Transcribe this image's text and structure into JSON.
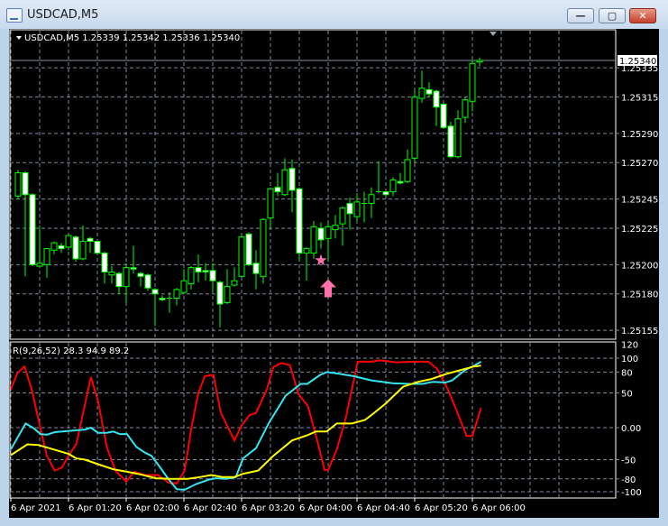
{
  "window": {
    "title": "USDCAD,M5",
    "minimize_label": "—",
    "maximize_label": "▢",
    "close_label": "✕"
  },
  "chart_data": [
    {
      "type": "candlestick",
      "title": "USDCAD,M5",
      "header_values": "1.25339 1.25342 1.25336 1.25340",
      "current_price": "1.25340",
      "y_ticks": [
        "1.25335",
        "1.25315",
        "1.25290",
        "1.25270",
        "1.25245",
        "1.25225",
        "1.25200",
        "1.25180",
        "1.25155"
      ],
      "ylim": [
        1.2515,
        1.2534
      ],
      "colors": {
        "bull": "#00ff00",
        "bear_fill": "#ffffff",
        "grid": "#7d8a9c",
        "current_line": "#8a94a0"
      },
      "candles_ohlc": [
        [
          1.25247,
          1.25265,
          1.25245,
          1.25263
        ],
        [
          1.25263,
          1.25264,
          1.25192,
          1.25248
        ],
        [
          1.25248,
          1.25249,
          1.25199,
          1.252
        ],
        [
          1.25199,
          1.25227,
          1.25198,
          1.25201
        ],
        [
          1.252,
          1.25211,
          1.25191,
          1.25211
        ],
        [
          1.2521,
          1.25216,
          1.25207,
          1.25215
        ],
        [
          1.25213,
          1.25215,
          1.25208,
          1.25211
        ],
        [
          1.25212,
          1.25221,
          1.2521,
          1.2522
        ],
        [
          1.25219,
          1.2522,
          1.25202,
          1.25204
        ],
        [
          1.25204,
          1.25227,
          1.25203,
          1.25216
        ],
        [
          1.25218,
          1.25219,
          1.25208,
          1.25216
        ],
        [
          1.25216,
          1.25216,
          1.25207,
          1.25208
        ],
        [
          1.25208,
          1.25209,
          1.25187,
          1.25195
        ],
        [
          1.25193,
          1.25199,
          1.25187,
          1.25195
        ],
        [
          1.25194,
          1.25195,
          1.2518,
          1.25185
        ],
        [
          1.25185,
          1.25201,
          1.25174,
          1.25198
        ],
        [
          1.25198,
          1.25213,
          1.25194,
          1.25197
        ],
        [
          1.25194,
          1.25195,
          1.25185,
          1.25192
        ],
        [
          1.25193,
          1.25194,
          1.25182,
          1.25184
        ],
        [
          1.25183,
          1.25184,
          1.25158,
          1.2518
        ],
        [
          1.25177,
          1.25179,
          1.25175,
          1.25176
        ],
        [
          1.25177,
          1.25181,
          1.25167,
          1.25177
        ],
        [
          1.25177,
          1.25184,
          1.25172,
          1.25183
        ],
        [
          1.25181,
          1.25197,
          1.2518,
          1.25189
        ],
        [
          1.25187,
          1.25199,
          1.25183,
          1.25198
        ],
        [
          1.25198,
          1.25207,
          1.25188,
          1.25195
        ],
        [
          1.25196,
          1.25201,
          1.25189,
          1.25195
        ],
        [
          1.25196,
          1.25201,
          1.25181,
          1.25189
        ],
        [
          1.25188,
          1.25189,
          1.25157,
          1.25173
        ],
        [
          1.25174,
          1.25197,
          1.25173,
          1.25185
        ],
        [
          1.25186,
          1.25198,
          1.25185,
          1.25189
        ],
        [
          1.25192,
          1.25221,
          1.25191,
          1.25219
        ],
        [
          1.25221,
          1.25222,
          1.25199,
          1.252
        ],
        [
          1.25201,
          1.2521,
          1.25183,
          1.25194
        ],
        [
          1.25192,
          1.25232,
          1.25187,
          1.25231
        ],
        [
          1.25232,
          1.25253,
          1.25225,
          1.25252
        ],
        [
          1.25253,
          1.25263,
          1.25247,
          1.2525
        ],
        [
          1.25248,
          1.25273,
          1.25247,
          1.25265
        ],
        [
          1.25266,
          1.25272,
          1.25236,
          1.25251
        ],
        [
          1.25252,
          1.25253,
          1.25202,
          1.25208
        ],
        [
          1.25208,
          1.25212,
          1.25189,
          1.25211
        ],
        [
          1.25208,
          1.2523,
          1.25204,
          1.25226
        ],
        [
          1.25225,
          1.25229,
          1.25211,
          1.25217
        ],
        [
          1.25218,
          1.2523,
          1.25202,
          1.25226
        ],
        [
          1.25224,
          1.25234,
          1.25218,
          1.25227
        ],
        [
          1.25228,
          1.2524,
          1.25213,
          1.25239
        ],
        [
          1.25242,
          1.25246,
          1.25224,
          1.25235
        ],
        [
          1.25233,
          1.25249,
          1.2523,
          1.25243
        ],
        [
          1.25242,
          1.2525,
          1.25229,
          1.25242
        ],
        [
          1.25242,
          1.25253,
          1.25232,
          1.25248
        ],
        [
          1.2525,
          1.25271,
          1.25249,
          1.2525
        ],
        [
          1.2525,
          1.25251,
          1.25247,
          1.25248
        ],
        [
          1.2525,
          1.2526,
          1.25247,
          1.25258
        ],
        [
          1.25257,
          1.25263,
          1.25255,
          1.25256
        ],
        [
          1.25257,
          1.25279,
          1.25256,
          1.25272
        ],
        [
          1.25273,
          1.2532,
          1.2527,
          1.25315
        ],
        [
          1.25314,
          1.25333,
          1.25311,
          1.25321
        ],
        [
          1.2532,
          1.25325,
          1.25315,
          1.25317
        ],
        [
          1.25319,
          1.2532,
          1.25295,
          1.25308
        ],
        [
          1.2531,
          1.25311,
          1.25293,
          1.25294
        ],
        [
          1.25295,
          1.25298,
          1.25273,
          1.25274
        ],
        [
          1.25274,
          1.25306,
          1.25273,
          1.253
        ],
        [
          1.25301,
          1.25315,
          1.25297,
          1.25313
        ],
        [
          1.25312,
          1.2534,
          1.25305,
          1.25338
        ],
        [
          1.25339,
          1.25342,
          1.25336,
          1.2534
        ]
      ],
      "signals": [
        {
          "type": "star",
          "bar": 42,
          "price": 1.25203,
          "color": "#ff6fae"
        },
        {
          "type": "up-arrow",
          "bar": 43,
          "price": 1.2519,
          "color": "#ff6fae"
        }
      ]
    },
    {
      "type": "line",
      "title": "R(9,26,52) 28.3 94.9 89.2",
      "y_ticks": [
        "120",
        "100",
        "80",
        "50",
        "0.00",
        "-50",
        "-80",
        "-100"
      ],
      "y_tick_values": [
        120,
        100,
        80,
        50,
        0,
        -50,
        -80,
        -100
      ],
      "ylim": [
        -100,
        120
      ],
      "x_tick_labels": [
        "6 Apr 2021",
        "6 Apr 01:20",
        "6 Apr 02:00",
        "6 Apr 02:40",
        "6 Apr 03:20",
        "6 Apr 04:00",
        "6 Apr 04:40",
        "6 Apr 05:20",
        "6 Apr 06:00"
      ],
      "x_tick_bars": [
        -1,
        7,
        15,
        23,
        31,
        39,
        47,
        55,
        63
      ],
      "series": [
        {
          "name": "R9",
          "color": "#ff0000",
          "points": [
            [
              -1,
              55
            ],
            [
              -0.1,
              78
            ],
            [
              0.9,
              88
            ],
            [
              1.9,
              55
            ],
            [
              3.1,
              -1
            ],
            [
              4,
              -44
            ],
            [
              5.1,
              -67
            ],
            [
              6.1,
              -62
            ],
            [
              7,
              -44
            ],
            [
              8.1,
              -25
            ],
            [
              9,
              20
            ],
            [
              10.1,
              73
            ],
            [
              11.1,
              38
            ],
            [
              12.3,
              -30
            ],
            [
              13.5,
              -67
            ],
            [
              15,
              -84
            ],
            [
              16.1,
              -69
            ],
            [
              17.6,
              -74
            ],
            [
              19.4,
              -74
            ],
            [
              20.9,
              -86
            ],
            [
              22,
              -87
            ],
            [
              23.1,
              -67
            ],
            [
              24.1,
              3
            ],
            [
              25,
              50
            ],
            [
              25.9,
              74
            ],
            [
              27.1,
              76
            ],
            [
              28.1,
              22
            ],
            [
              30,
              -20
            ],
            [
              31,
              3
            ],
            [
              32.1,
              18
            ],
            [
              33,
              21
            ],
            [
              34.5,
              55
            ],
            [
              35.4,
              87
            ],
            [
              36.5,
              93
            ],
            [
              37.7,
              90
            ],
            [
              38.9,
              48
            ],
            [
              40.2,
              31
            ],
            [
              41.6,
              -25
            ],
            [
              42.5,
              -66
            ],
            [
              43,
              -66
            ],
            [
              44.2,
              -34
            ],
            [
              45.4,
              12
            ],
            [
              47.1,
              95
            ],
            [
              49,
              95
            ],
            [
              50.1,
              97
            ],
            [
              52.5,
              94
            ],
            [
              54.9,
              95
            ],
            [
              56.9,
              95
            ],
            [
              58.1,
              85
            ],
            [
              59.6,
              55
            ],
            [
              60.8,
              25
            ],
            [
              62.2,
              -13
            ],
            [
              63,
              -13
            ],
            [
              64.2,
              28.3
            ]
          ]
        },
        {
          "name": "R26",
          "color": "#33e6f0",
          "points": [
            [
              -1,
              -34
            ],
            [
              1.05,
              6
            ],
            [
              2.2,
              -1
            ],
            [
              3.1,
              -10
            ],
            [
              4,
              -11
            ],
            [
              5.1,
              -7
            ],
            [
              7,
              -5
            ],
            [
              9.3,
              -3
            ],
            [
              10.1,
              0
            ],
            [
              11.1,
              -8
            ],
            [
              12.3,
              -8
            ],
            [
              13.2,
              -6
            ],
            [
              14.1,
              -10
            ],
            [
              15.1,
              -10
            ],
            [
              16.4,
              -30
            ],
            [
              17.6,
              -39
            ],
            [
              18.5,
              -44
            ],
            [
              19.7,
              -62
            ],
            [
              20.9,
              -81
            ],
            [
              22,
              -96
            ],
            [
              23.1,
              -97
            ],
            [
              24.7,
              -88
            ],
            [
              26.5,
              -81
            ],
            [
              27.4,
              -79
            ],
            [
              28.9,
              -80
            ],
            [
              30.2,
              -77
            ],
            [
              31.2,
              -48
            ],
            [
              33,
              -32
            ],
            [
              34.8,
              7
            ],
            [
              37.1,
              46
            ],
            [
              39.2,
              63
            ],
            [
              40.1,
              63
            ],
            [
              41.9,
              76
            ],
            [
              42.8,
              80
            ],
            [
              44.2,
              78
            ],
            [
              46.6,
              74
            ],
            [
              49,
              68
            ],
            [
              51.9,
              64
            ],
            [
              54.3,
              63
            ],
            [
              56.1,
              63
            ],
            [
              57.5,
              66
            ],
            [
              59.3,
              65
            ],
            [
              60.2,
              68
            ],
            [
              62,
              83
            ],
            [
              63.2,
              89
            ],
            [
              64.2,
              94.9
            ]
          ]
        },
        {
          "name": "R52",
          "color": "#ffff00",
          "points": [
            [
              -1,
              -43
            ],
            [
              1.3,
              -26
            ],
            [
              2.8,
              -27
            ],
            [
              4.9,
              -34
            ],
            [
              7,
              -41
            ],
            [
              8.1,
              -48
            ],
            [
              9.3,
              -50
            ],
            [
              11.1,
              -57
            ],
            [
              13.2,
              -65
            ],
            [
              15.2,
              -69
            ],
            [
              17,
              -73
            ],
            [
              19.1,
              -79
            ],
            [
              21.2,
              -80
            ],
            [
              23.5,
              -80
            ],
            [
              25.3,
              -77
            ],
            [
              26.8,
              -74
            ],
            [
              28.3,
              -77
            ],
            [
              30,
              -77
            ],
            [
              31.2,
              -72
            ],
            [
              33.3,
              -67
            ],
            [
              35.4,
              -44
            ],
            [
              38,
              -20
            ],
            [
              40.1,
              -12
            ],
            [
              41.3,
              -6
            ],
            [
              42.8,
              -6
            ],
            [
              44.2,
              6
            ],
            [
              46.3,
              6
            ],
            [
              48.1,
              11
            ],
            [
              49,
              18
            ],
            [
              51,
              35
            ],
            [
              53.4,
              59
            ],
            [
              55.5,
              66
            ],
            [
              57.3,
              70
            ],
            [
              59.3,
              77
            ],
            [
              61.4,
              83
            ],
            [
              63.2,
              88
            ],
            [
              64.2,
              89.2
            ]
          ]
        }
      ]
    }
  ]
}
